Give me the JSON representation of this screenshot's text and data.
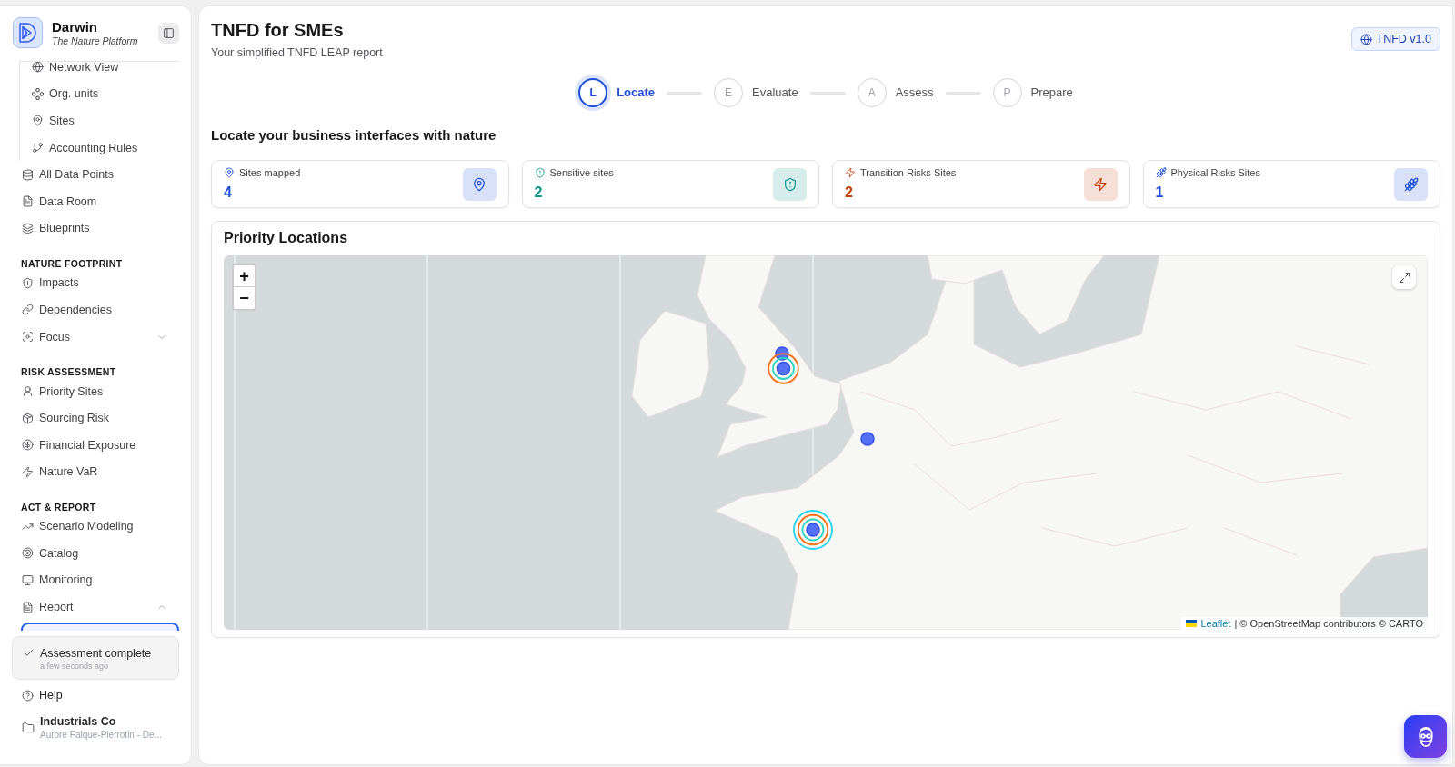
{
  "sidebar": {
    "brand": {
      "name": "Darwin",
      "tagline": "The Nature Platform"
    },
    "nested_items": [
      {
        "label": "Network View"
      },
      {
        "label": "Org. units"
      },
      {
        "label": "Sites"
      },
      {
        "label": "Accounting Rules"
      }
    ],
    "sections": [
      {
        "items": [
          {
            "label": "All Data Points"
          },
          {
            "label": "Data Room"
          },
          {
            "label": "Blueprints"
          }
        ]
      },
      {
        "title": "NATURE FOOTPRINT",
        "items": [
          {
            "label": "Impacts"
          },
          {
            "label": "Dependencies"
          },
          {
            "label": "Focus",
            "expanded": false
          }
        ]
      },
      {
        "title": "RISK ASSESSMENT",
        "items": [
          {
            "label": "Priority Sites"
          },
          {
            "label": "Sourcing Risk"
          },
          {
            "label": "Financial Exposure"
          },
          {
            "label": "Nature VaR"
          }
        ]
      },
      {
        "title": "ACT & REPORT",
        "items": [
          {
            "label": "Scenario Modeling"
          },
          {
            "label": "Catalog"
          },
          {
            "label": "Monitoring"
          },
          {
            "label": "Report",
            "expanded": true,
            "children": [
              {
                "selected": true
              }
            ]
          }
        ]
      }
    ],
    "notification": {
      "title": "Assessment complete",
      "time": "a few seconds ago"
    },
    "help": "Help",
    "organization": {
      "name": "Industrials Co",
      "subtitle": "Aurore Falque-Pierrotin - De..."
    }
  },
  "header": {
    "title": "TNFD for SMEs",
    "subtitle": "Your simplified TNFD LEAP report",
    "badge": "TNFD v1.0"
  },
  "steps": [
    {
      "letter": "L",
      "label": "Locate",
      "selected": true
    },
    {
      "letter": "E",
      "label": "Evaluate",
      "selected": false
    },
    {
      "letter": "A",
      "label": "Assess",
      "selected": false
    },
    {
      "letter": "P",
      "label": "Prepare",
      "selected": false
    }
  ],
  "section_title": "Locate your business interfaces with nature",
  "stats": [
    {
      "label": "Sites mapped",
      "value": "4",
      "color": "#1d4ed8"
    },
    {
      "label": "Sensitive sites",
      "value": "2",
      "color": "#0d9488"
    },
    {
      "label": "Transition Risks Sites",
      "value": "2",
      "color": "#c2410c"
    },
    {
      "label": "Physical Risks Sites",
      "value": "1",
      "color": "#1d4ed8"
    }
  ],
  "map_card": {
    "title": "Priority Locations",
    "zoom_in": "+",
    "zoom_out": "−",
    "markers": [
      {
        "kind": "dot"
      },
      {
        "kind": "ringed",
        "rings": [
          {
            "color": "#2dd4bf"
          },
          {
            "color": "#f97316"
          }
        ]
      },
      {
        "kind": "dot"
      },
      {
        "kind": "ringed",
        "rings": [
          {
            "color": "#2dd4bf"
          },
          {
            "color": "#f97316"
          },
          {
            "color": "#22d3ee"
          }
        ]
      }
    ],
    "attribution_link": "Leaflet",
    "attribution": "| © OpenStreetMap contributors © CARTO"
  }
}
